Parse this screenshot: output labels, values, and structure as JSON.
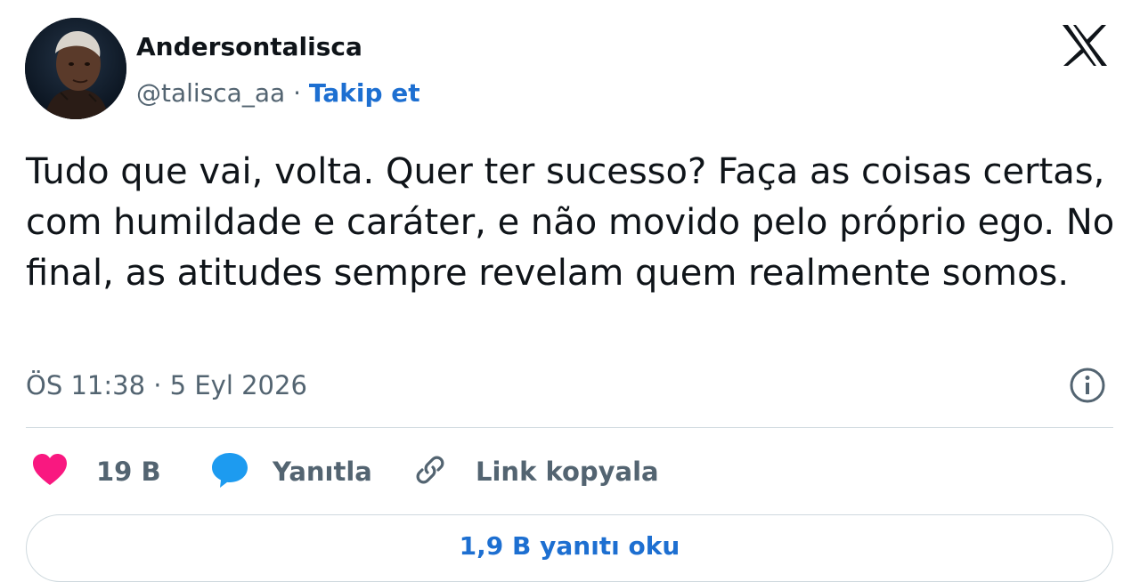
{
  "author": {
    "name": "Andersontalisca",
    "handle": "@talisca_aa",
    "separator": "·",
    "follow_label": "Takip et",
    "avatar_icon": "user-avatar-photo"
  },
  "platform_logo": "x-logo-icon",
  "tweet": {
    "text": "Tudo que vai, volta. Quer ter sucesso? Faça as coisas certas, com humildade e caráter, e não movido pelo próprio ego. No final, as atitudes sempre revelam quem realmente somos.",
    "timestamp": "ÖS 11:38 · 5 Eyl 2026"
  },
  "actions": {
    "like_count": "19 B",
    "reply_label": "Yanıtla",
    "copy_link_label": "Link kopyala",
    "read_replies_label": "1,9 B yanıtı oku"
  },
  "colors": {
    "accent_blue": "#1d6fd1",
    "like_pink": "#f91880",
    "reply_blue": "#1d9bf0",
    "secondary_text": "#536471",
    "border": "#cfd9de"
  }
}
